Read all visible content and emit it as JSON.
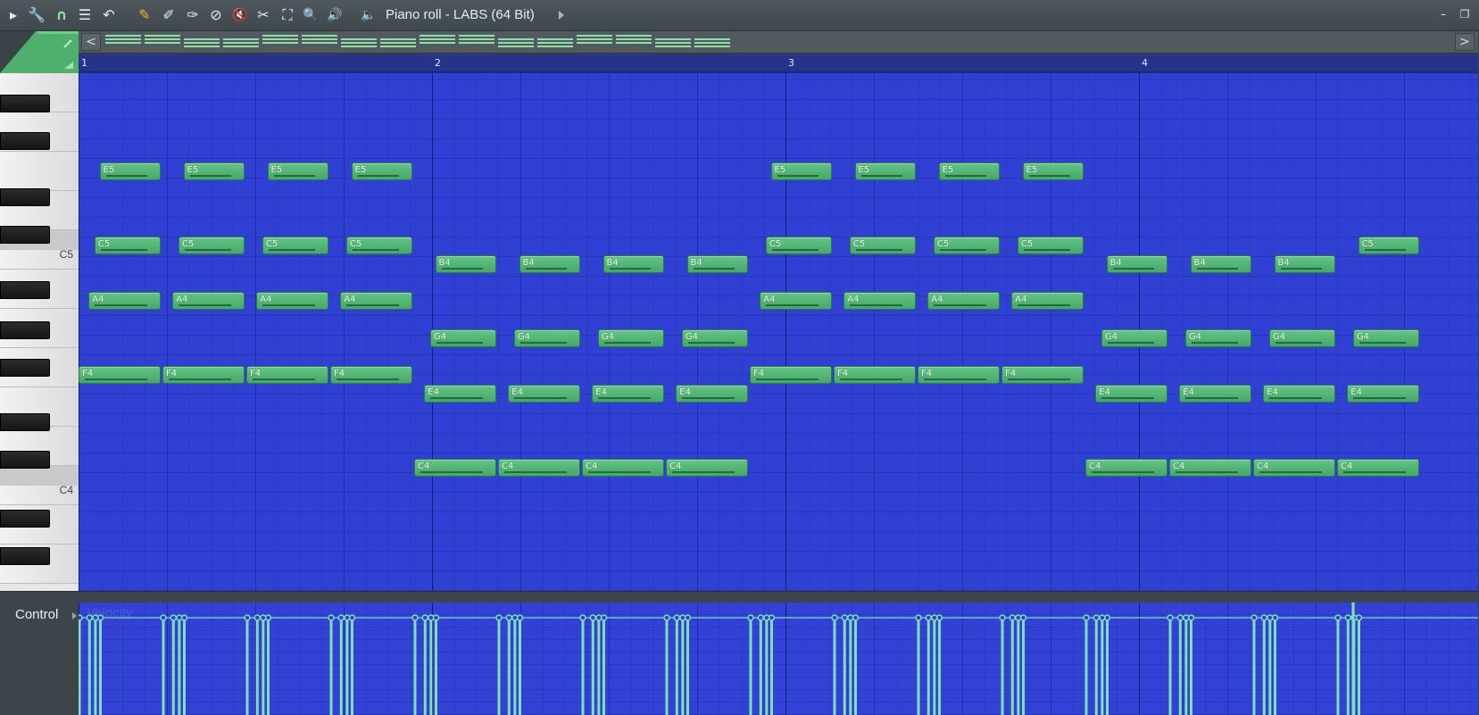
{
  "window": {
    "title": "Piano roll - LABS (64 Bit)",
    "minimize_glyph": "–",
    "restore_glyph": "❐"
  },
  "toolbar": {
    "icons": [
      {
        "name": "menu-arrow-icon",
        "glyph": "▸"
      },
      {
        "name": "wrench-icon",
        "glyph": "🔧"
      },
      {
        "name": "magnet-icon",
        "glyph": "∩"
      },
      {
        "name": "list-icon",
        "glyph": "☰"
      },
      {
        "name": "undo-icon",
        "glyph": "↶"
      },
      {
        "name": "pencil-icon",
        "glyph": "✎"
      },
      {
        "name": "brush-icon",
        "glyph": "✐"
      },
      {
        "name": "paint-icon",
        "glyph": "✑"
      },
      {
        "name": "delete-icon",
        "glyph": "⊘"
      },
      {
        "name": "mute-icon",
        "glyph": "🔇"
      },
      {
        "name": "slice-icon",
        "glyph": "✂"
      },
      {
        "name": "select-icon",
        "glyph": "⛶"
      },
      {
        "name": "zoom-icon",
        "glyph": "🔍"
      },
      {
        "name": "playback-icon",
        "glyph": "🔊"
      },
      {
        "name": "speaker-icon",
        "glyph": "🔈"
      }
    ]
  },
  "overview": {
    "left_arrow": "<",
    "right_arrow": ">"
  },
  "ruler": {
    "bars": [
      "1",
      "2",
      "3",
      "4"
    ]
  },
  "keyboard": {
    "labels": {
      "c5": "C5",
      "c4": "C4"
    }
  },
  "colors": {
    "grid": "#2f40d2",
    "note": "#55b876",
    "velocity": "#7fe0b8"
  },
  "notes": [
    {
      "label": "E5",
      "row": "E5",
      "start": 0.25,
      "len": 0.75
    },
    {
      "label": "E5",
      "row": "E5",
      "start": 1.25,
      "len": 0.75
    },
    {
      "label": "E5",
      "row": "E5",
      "start": 2.25,
      "len": 0.75
    },
    {
      "label": "E5",
      "row": "E5",
      "start": 3.25,
      "len": 0.75
    },
    {
      "label": "C5",
      "row": "C5",
      "start": 0.19,
      "len": 0.81
    },
    {
      "label": "C5",
      "row": "C5",
      "start": 1.19,
      "len": 0.81
    },
    {
      "label": "C5",
      "row": "C5",
      "start": 2.19,
      "len": 0.81
    },
    {
      "label": "C5",
      "row": "C5",
      "start": 3.19,
      "len": 0.81
    },
    {
      "label": "A4",
      "row": "A4",
      "start": 0.12,
      "len": 0.88
    },
    {
      "label": "A4",
      "row": "A4",
      "start": 1.12,
      "len": 0.88
    },
    {
      "label": "A4",
      "row": "A4",
      "start": 2.12,
      "len": 0.88
    },
    {
      "label": "A4",
      "row": "A4",
      "start": 3.12,
      "len": 0.88
    },
    {
      "label": "F4",
      "row": "F4",
      "start": 0.0,
      "len": 1.0
    },
    {
      "label": "F4",
      "row": "F4",
      "start": 1.0,
      "len": 1.0
    },
    {
      "label": "F4",
      "row": "F4",
      "start": 2.0,
      "len": 1.0
    },
    {
      "label": "F4",
      "row": "F4",
      "start": 3.0,
      "len": 1.0
    },
    {
      "label": "B4",
      "row": "B4",
      "start": 4.25,
      "len": 0.75
    },
    {
      "label": "B4",
      "row": "B4",
      "start": 5.25,
      "len": 0.75
    },
    {
      "label": "B4",
      "row": "B4",
      "start": 6.25,
      "len": 0.75
    },
    {
      "label": "B4",
      "row": "B4",
      "start": 7.25,
      "len": 0.75
    },
    {
      "label": "G4",
      "row": "G4",
      "start": 4.19,
      "len": 0.81
    },
    {
      "label": "G4",
      "row": "G4",
      "start": 5.19,
      "len": 0.81
    },
    {
      "label": "G4",
      "row": "G4",
      "start": 6.19,
      "len": 0.81
    },
    {
      "label": "G4",
      "row": "G4",
      "start": 7.19,
      "len": 0.81
    },
    {
      "label": "E4",
      "row": "E4",
      "start": 4.12,
      "len": 0.88
    },
    {
      "label": "E4",
      "row": "E4",
      "start": 5.12,
      "len": 0.88
    },
    {
      "label": "E4",
      "row": "E4",
      "start": 6.12,
      "len": 0.88
    },
    {
      "label": "E4",
      "row": "E4",
      "start": 7.12,
      "len": 0.88
    },
    {
      "label": "C4",
      "row": "C4",
      "start": 4.0,
      "len": 1.0
    },
    {
      "label": "C4",
      "row": "C4",
      "start": 5.0,
      "len": 1.0
    },
    {
      "label": "C4",
      "row": "C4",
      "start": 6.0,
      "len": 1.0
    },
    {
      "label": "C4",
      "row": "C4",
      "start": 7.0,
      "len": 1.0
    },
    {
      "label": "E5",
      "row": "E5",
      "start": 8.25,
      "len": 0.75
    },
    {
      "label": "E5",
      "row": "E5",
      "start": 9.25,
      "len": 0.75
    },
    {
      "label": "E5",
      "row": "E5",
      "start": 10.25,
      "len": 0.75
    },
    {
      "label": "E5",
      "row": "E5",
      "start": 11.25,
      "len": 0.75
    },
    {
      "label": "C5",
      "row": "C5",
      "start": 8.19,
      "len": 0.81
    },
    {
      "label": "C5",
      "row": "C5",
      "start": 9.19,
      "len": 0.81
    },
    {
      "label": "C5",
      "row": "C5",
      "start": 10.19,
      "len": 0.81
    },
    {
      "label": "C5",
      "row": "C5",
      "start": 11.19,
      "len": 0.81
    },
    {
      "label": "A4",
      "row": "A4",
      "start": 8.12,
      "len": 0.88
    },
    {
      "label": "A4",
      "row": "A4",
      "start": 9.12,
      "len": 0.88
    },
    {
      "label": "A4",
      "row": "A4",
      "start": 10.12,
      "len": 0.88
    },
    {
      "label": "A4",
      "row": "A4",
      "start": 11.12,
      "len": 0.88
    },
    {
      "label": "F4",
      "row": "F4",
      "start": 8.0,
      "len": 1.0
    },
    {
      "label": "F4",
      "row": "F4",
      "start": 9.0,
      "len": 1.0
    },
    {
      "label": "F4",
      "row": "F4",
      "start": 10.0,
      "len": 1.0
    },
    {
      "label": "F4",
      "row": "F4",
      "start": 11.0,
      "len": 1.0
    },
    {
      "label": "B4",
      "row": "B4",
      "start": 12.25,
      "len": 0.75
    },
    {
      "label": "B4",
      "row": "B4",
      "start": 13.25,
      "len": 0.75
    },
    {
      "label": "B4",
      "row": "B4",
      "start": 14.25,
      "len": 0.75
    },
    {
      "label": "G4",
      "row": "G4",
      "start": 12.19,
      "len": 0.81
    },
    {
      "label": "G4",
      "row": "G4",
      "start": 13.19,
      "len": 0.81
    },
    {
      "label": "G4",
      "row": "G4",
      "start": 14.19,
      "len": 0.81
    },
    {
      "label": "G4",
      "row": "G4",
      "start": 15.19,
      "len": 0.81
    },
    {
      "label": "E4",
      "row": "E4",
      "start": 12.12,
      "len": 0.88
    },
    {
      "label": "E4",
      "row": "E4",
      "start": 13.12,
      "len": 0.88
    },
    {
      "label": "E4",
      "row": "E4",
      "start": 14.12,
      "len": 0.88
    },
    {
      "label": "E4",
      "row": "E4",
      "start": 15.12,
      "len": 0.88
    },
    {
      "label": "C4",
      "row": "C4",
      "start": 12.0,
      "len": 1.0
    },
    {
      "label": "C4",
      "row": "C4",
      "start": 13.0,
      "len": 1.0
    },
    {
      "label": "C4",
      "row": "C4",
      "start": 14.0,
      "len": 1.0
    },
    {
      "label": "C4",
      "row": "C4",
      "start": 15.0,
      "len": 1.0
    },
    {
      "label": "C5",
      "row": "C5",
      "start": 15.25,
      "len": 0.75
    }
  ],
  "control": {
    "label": "Control",
    "param": "Velocity"
  }
}
